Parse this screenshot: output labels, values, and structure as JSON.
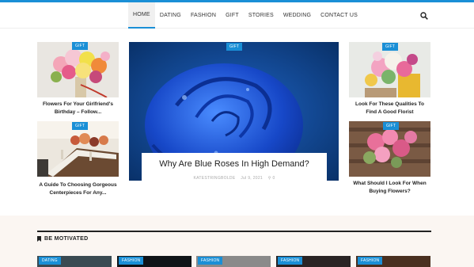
{
  "nav": {
    "items": [
      {
        "label": "HOME",
        "active": true
      },
      {
        "label": "DATING",
        "active": false
      },
      {
        "label": "FASHION",
        "active": false
      },
      {
        "label": "GIFT",
        "active": false
      },
      {
        "label": "STORIES",
        "active": false
      },
      {
        "label": "WEDDING",
        "active": false
      },
      {
        "label": "CONTACT US",
        "active": false
      }
    ],
    "search_icon": "search-icon"
  },
  "cards": {
    "top_left": {
      "badge": "GIFT",
      "title": "Flowers For Your Girlfriend's Birthday – Follow..."
    },
    "bottom_left": {
      "badge": "GIFT",
      "title": "A Guide To Choosing Gorgeous Centerpieces For Any..."
    },
    "top_right": {
      "badge": "GIFT",
      "title": "Look For These Qualities To Find A Good Florist"
    },
    "bottom_right": {
      "badge": "GIFT",
      "title": "What Should I Look For When Buying Flowers?"
    }
  },
  "hero": {
    "badge": "GIFT",
    "title": "Why Are Blue Roses In High Demand?",
    "author": "KATESTRINGBOLDE",
    "date": "Jul 9, 2021",
    "comments": "0"
  },
  "section": {
    "heading": "BE MOTIVATED",
    "strip_badges": [
      "DATING",
      "FASHION",
      "FASHION",
      "FASHION",
      "FASHION"
    ]
  },
  "colors": {
    "accent": "#1a8fd6",
    "section_bg": "#fbf6f2"
  }
}
